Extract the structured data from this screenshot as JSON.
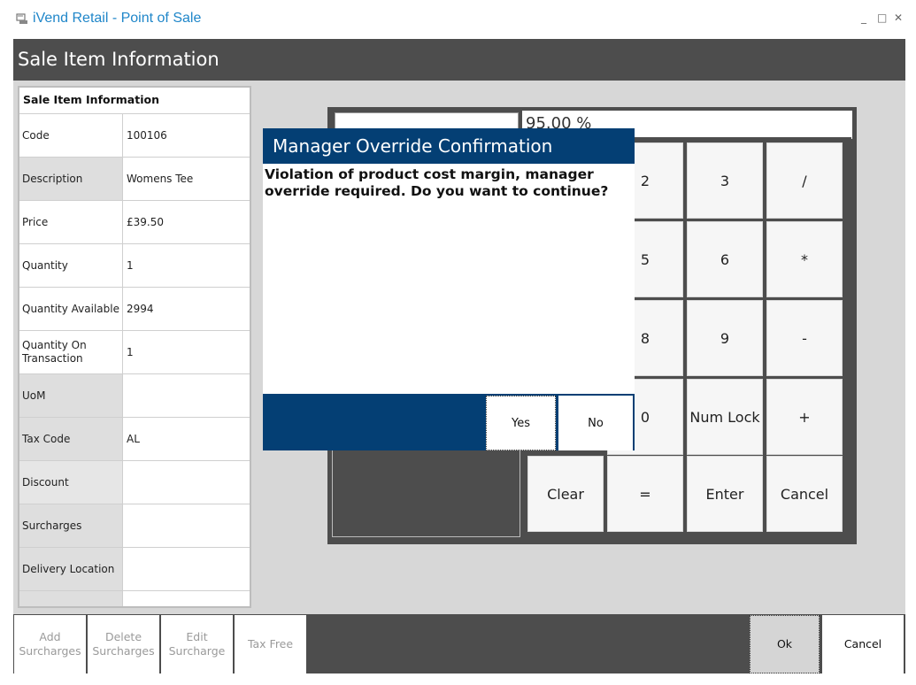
{
  "window": {
    "title": "iVend Retail - Point of Sale",
    "icon": "app-icon",
    "minimize": "_",
    "maximize": "□",
    "close": "✕"
  },
  "header": {
    "title": "Sale Item Information"
  },
  "info": {
    "heading": "Sale Item Information",
    "rows": [
      {
        "label": "Code",
        "value": "100106"
      },
      {
        "label": "Description",
        "value": "Womens Tee"
      },
      {
        "label": "Price",
        "value": "£39.50"
      },
      {
        "label": "Quantity",
        "value": "1"
      },
      {
        "label": "Quantity Available",
        "value": "2994"
      },
      {
        "label": "Quantity On Transaction",
        "value": "1"
      },
      {
        "label": "UoM",
        "value": ""
      },
      {
        "label": "Tax Code",
        "value": "AL"
      },
      {
        "label": "Discount",
        "value": ""
      },
      {
        "label": "Surcharges",
        "value": ""
      },
      {
        "label": "Delivery Location",
        "value": ""
      }
    ]
  },
  "keypad": {
    "display": "95.00 %",
    "keys": [
      "2",
      "3",
      "/",
      "5",
      "6",
      "*",
      "8",
      "9",
      "-",
      "0",
      "Num Lock",
      "+",
      "Clear",
      "=",
      "Enter",
      "Cancel"
    ]
  },
  "dialog": {
    "title": "Manager Override Confirmation",
    "message": "Violation of product cost margin, manager override required. Do you want to continue?",
    "yes": "Yes",
    "no": "No"
  },
  "toolbar": {
    "add_surcharges": "Add Surcharges",
    "delete_surcharges": "Delete Surcharges",
    "edit_surcharge": "Edit Surcharge",
    "tax_free": "Tax Free",
    "ok": "Ok",
    "cancel": "Cancel"
  },
  "colors": {
    "accent": "#043f74",
    "header": "#4d4d4d",
    "title": "#1f86c9"
  }
}
